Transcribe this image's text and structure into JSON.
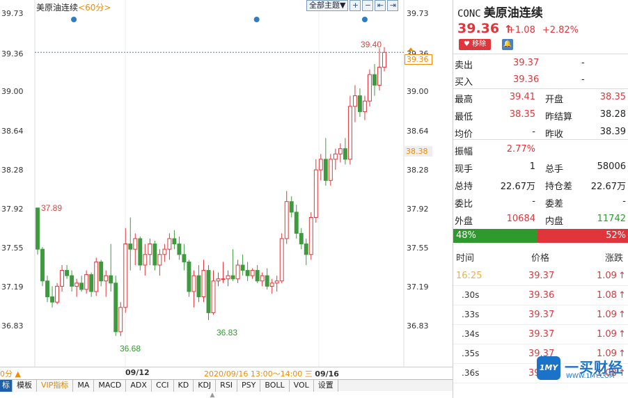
{
  "chart": {
    "title": "美原油连续",
    "period": "<60分>",
    "toolbar": {
      "dropdown": "全部主题▼",
      "icons": [
        "zoom-in-icon",
        "zoom-out-icon",
        "left-end-icon",
        "right-end-icon"
      ]
    },
    "y_ticks": [
      "39.73",
      "39.36",
      "39.00",
      "38.64",
      "38.28",
      "37.92",
      "37.55",
      "37.19",
      "36.83"
    ],
    "current_price_tag": "39.36",
    "ref_price_tag": "38.38",
    "annotations": {
      "high": "39.40",
      "low1": "36.68",
      "low2": "36.83",
      "start": "37.89"
    },
    "time_axis": {
      "left": "0分 ▲",
      "date1": "09/12",
      "range_text": "2020/09/16 13:00～14:00 三",
      "date2": "09/16"
    }
  },
  "chart_data": {
    "type": "candlestick",
    "title": "美原油连续",
    "ylim": [
      36.62,
      39.73
    ],
    "up_color": "#e0363b",
    "down_color": "#3e9a3e",
    "candles": [
      {
        "o": 37.89,
        "h": 37.89,
        "l": 37.45,
        "c": 37.5
      },
      {
        "o": 37.5,
        "h": 37.52,
        "l": 37.15,
        "c": 37.2
      },
      {
        "o": 37.2,
        "h": 37.25,
        "l": 37.0,
        "c": 37.05
      },
      {
        "o": 37.05,
        "h": 37.15,
        "l": 36.95,
        "c": 37.0
      },
      {
        "o": 37.0,
        "h": 37.18,
        "l": 36.98,
        "c": 37.15
      },
      {
        "o": 37.15,
        "h": 37.35,
        "l": 37.1,
        "c": 37.3
      },
      {
        "o": 37.3,
        "h": 37.35,
        "l": 37.22,
        "c": 37.25
      },
      {
        "o": 37.25,
        "h": 37.3,
        "l": 37.1,
        "c": 37.15
      },
      {
        "o": 37.15,
        "h": 37.22,
        "l": 37.05,
        "c": 37.18
      },
      {
        "o": 37.18,
        "h": 37.25,
        "l": 37.1,
        "c": 37.12
      },
      {
        "o": 37.12,
        "h": 37.3,
        "l": 37.08,
        "c": 37.26
      },
      {
        "o": 37.26,
        "h": 37.28,
        "l": 37.05,
        "c": 37.1
      },
      {
        "o": 37.1,
        "h": 37.42,
        "l": 37.06,
        "c": 37.38
      },
      {
        "o": 37.38,
        "h": 37.4,
        "l": 37.15,
        "c": 37.2
      },
      {
        "o": 37.2,
        "h": 37.3,
        "l": 37.05,
        "c": 37.25
      },
      {
        "o": 37.25,
        "h": 37.55,
        "l": 37.1,
        "c": 37.18
      },
      {
        "o": 37.18,
        "h": 37.25,
        "l": 36.68,
        "c": 36.72
      },
      {
        "o": 36.72,
        "h": 37.0,
        "l": 36.68,
        "c": 36.95
      },
      {
        "o": 36.95,
        "h": 37.7,
        "l": 36.9,
        "c": 37.55
      },
      {
        "o": 37.55,
        "h": 37.8,
        "l": 37.3,
        "c": 37.5
      },
      {
        "o": 37.5,
        "h": 37.65,
        "l": 37.35,
        "c": 37.6
      },
      {
        "o": 37.6,
        "h": 37.62,
        "l": 37.3,
        "c": 37.35
      },
      {
        "o": 37.35,
        "h": 37.55,
        "l": 37.25,
        "c": 37.45
      },
      {
        "o": 37.45,
        "h": 37.6,
        "l": 37.35,
        "c": 37.55
      },
      {
        "o": 37.55,
        "h": 37.58,
        "l": 37.3,
        "c": 37.35
      },
      {
        "o": 37.35,
        "h": 37.5,
        "l": 37.25,
        "c": 37.45
      },
      {
        "o": 37.45,
        "h": 37.55,
        "l": 37.38,
        "c": 37.5
      },
      {
        "o": 37.5,
        "h": 37.65,
        "l": 37.4,
        "c": 37.6
      },
      {
        "o": 37.6,
        "h": 37.68,
        "l": 37.5,
        "c": 37.55
      },
      {
        "o": 37.55,
        "h": 37.62,
        "l": 37.4,
        "c": 37.45
      },
      {
        "o": 37.45,
        "h": 37.55,
        "l": 37.3,
        "c": 37.38
      },
      {
        "o": 37.38,
        "h": 37.4,
        "l": 37.05,
        "c": 37.1
      },
      {
        "o": 37.1,
        "h": 37.3,
        "l": 36.95,
        "c": 37.25
      },
      {
        "o": 37.25,
        "h": 37.35,
        "l": 37.0,
        "c": 37.05
      },
      {
        "o": 37.05,
        "h": 37.4,
        "l": 37.0,
        "c": 37.3
      },
      {
        "o": 37.3,
        "h": 37.35,
        "l": 36.83,
        "c": 36.9
      },
      {
        "o": 36.9,
        "h": 37.3,
        "l": 36.88,
        "c": 37.2
      },
      {
        "o": 37.2,
        "h": 37.28,
        "l": 37.15,
        "c": 37.22
      },
      {
        "o": 37.22,
        "h": 37.38,
        "l": 37.18,
        "c": 37.22
      },
      {
        "o": 37.22,
        "h": 37.3,
        "l": 37.15,
        "c": 37.25
      },
      {
        "o": 37.25,
        "h": 37.5,
        "l": 37.2,
        "c": 37.22
      },
      {
        "o": 37.22,
        "h": 37.4,
        "l": 37.18,
        "c": 37.35
      },
      {
        "o": 37.35,
        "h": 37.45,
        "l": 37.25,
        "c": 37.3
      },
      {
        "o": 37.3,
        "h": 37.38,
        "l": 37.2,
        "c": 37.25
      },
      {
        "o": 37.25,
        "h": 37.32,
        "l": 37.22,
        "c": 37.3
      },
      {
        "o": 37.3,
        "h": 37.35,
        "l": 37.18,
        "c": 37.2
      },
      {
        "o": 37.2,
        "h": 37.28,
        "l": 37.15,
        "c": 37.25
      },
      {
        "o": 37.25,
        "h": 37.32,
        "l": 37.12,
        "c": 37.15
      },
      {
        "o": 37.15,
        "h": 37.22,
        "l": 37.08,
        "c": 37.18
      },
      {
        "o": 37.18,
        "h": 37.25,
        "l": 37.1,
        "c": 37.2
      },
      {
        "o": 37.2,
        "h": 37.65,
        "l": 37.18,
        "c": 37.6
      },
      {
        "o": 37.6,
        "h": 38.05,
        "l": 37.55,
        "c": 37.95
      },
      {
        "o": 37.95,
        "h": 38.0,
        "l": 37.8,
        "c": 37.85
      },
      {
        "o": 37.85,
        "h": 37.92,
        "l": 37.6,
        "c": 37.65
      },
      {
        "o": 37.65,
        "h": 37.7,
        "l": 37.5,
        "c": 37.55
      },
      {
        "o": 37.55,
        "h": 37.6,
        "l": 37.35,
        "c": 37.45
      },
      {
        "o": 37.45,
        "h": 37.85,
        "l": 37.4,
        "c": 37.8
      },
      {
        "o": 37.8,
        "h": 38.35,
        "l": 37.75,
        "c": 38.25
      },
      {
        "o": 38.25,
        "h": 38.4,
        "l": 38.15,
        "c": 38.35
      },
      {
        "o": 38.35,
        "h": 38.55,
        "l": 38.1,
        "c": 38.15
      },
      {
        "o": 38.15,
        "h": 38.4,
        "l": 38.1,
        "c": 38.35
      },
      {
        "o": 38.35,
        "h": 38.45,
        "l": 38.25,
        "c": 38.4
      },
      {
        "o": 38.4,
        "h": 38.5,
        "l": 38.32,
        "c": 38.45
      },
      {
        "o": 38.45,
        "h": 38.55,
        "l": 38.3,
        "c": 38.35
      },
      {
        "o": 38.35,
        "h": 38.95,
        "l": 38.3,
        "c": 38.85
      },
      {
        "o": 38.85,
        "h": 39.05,
        "l": 38.7,
        "c": 38.95
      },
      {
        "o": 38.95,
        "h": 39.02,
        "l": 38.75,
        "c": 38.8
      },
      {
        "o": 38.8,
        "h": 38.95,
        "l": 38.72,
        "c": 38.9
      },
      {
        "o": 38.9,
        "h": 39.2,
        "l": 38.85,
        "c": 39.15
      },
      {
        "o": 39.15,
        "h": 39.25,
        "l": 38.95,
        "c": 39.05
      },
      {
        "o": 39.05,
        "h": 39.4,
        "l": 39.0,
        "c": 39.22
      },
      {
        "o": 39.22,
        "h": 39.41,
        "l": 39.18,
        "c": 39.36
      }
    ],
    "event_dots": [
      4,
      46,
      67
    ]
  },
  "side": {
    "code": "CONC",
    "name": "美原油连续",
    "price": "39.36",
    "arrow": "↑",
    "change": "+1.08",
    "change_pct": "+2.82%",
    "remove_btn": "♥ 移除",
    "bell_btn": "🔔",
    "sell": {
      "label": "卖出",
      "price": "39.37",
      "vol": "-"
    },
    "buy": {
      "label": "买入",
      "price": "39.36",
      "vol": "-"
    },
    "stats": [
      {
        "l1": "最高",
        "v1": "39.41",
        "c1": "red",
        "l2": "开盘",
        "v2": "38.35",
        "c2": "red"
      },
      {
        "l1": "最低",
        "v1": "38.35",
        "c1": "red",
        "l2": "昨结算",
        "v2": "38.28",
        "c2": "dark"
      },
      {
        "l1": "均价",
        "v1": "-",
        "c1": "dark",
        "l2": "昨收",
        "v2": "38.39",
        "c2": "dark"
      },
      {
        "l1": "振幅",
        "v1": "2.77%",
        "c1": "red",
        "l2": "",
        "v2": "",
        "c2": "dark"
      },
      {
        "l1": "现手",
        "v1": "1",
        "c1": "dark",
        "l2": "总手",
        "v2": "58006",
        "c2": "dark"
      },
      {
        "l1": "总持",
        "v1": "22.67万",
        "c1": "dark",
        "l2": "持仓差",
        "v2": "22.67万",
        "c2": "dark"
      },
      {
        "l1": "委比",
        "v1": "-",
        "c1": "dark",
        "l2": "委差",
        "v2": "-",
        "c2": "dark"
      },
      {
        "l1": "外盘",
        "v1": "10684",
        "c1": "red",
        "l2": "内盘",
        "v2": "11742",
        "c2": "green"
      }
    ],
    "ratio": {
      "green_pct": "48%",
      "red_pct": "52%",
      "green_frac": 0.48
    },
    "tick_header": {
      "time": "时间",
      "price": "价格",
      "chg": "涨跌"
    },
    "ticks": [
      {
        "t": "16:25",
        "p": "39.37",
        "d": "1.09"
      },
      {
        "t": ".30s",
        "p": "39.36",
        "d": "1.08"
      },
      {
        "t": ".33s",
        "p": "39.37",
        "d": "1.09"
      },
      {
        "t": ".34s",
        "p": "39.37",
        "d": "1.09"
      },
      {
        "t": ".35s",
        "p": "39.37",
        "d": "1.09"
      },
      {
        "t": ".36s",
        "p": "39.36",
        "d": "1.08"
      }
    ],
    "watermark": {
      "logo": "1MY",
      "text": "一买财经",
      "url": "WWW.1MY.COM"
    }
  },
  "tabs": [
    "标",
    "模板",
    "VIP指标",
    "MA",
    "MACD",
    "ADX",
    "CCI",
    "KD",
    "KDJ",
    "RSI",
    "PSY",
    "BOLL",
    "VOL",
    "设置"
  ]
}
